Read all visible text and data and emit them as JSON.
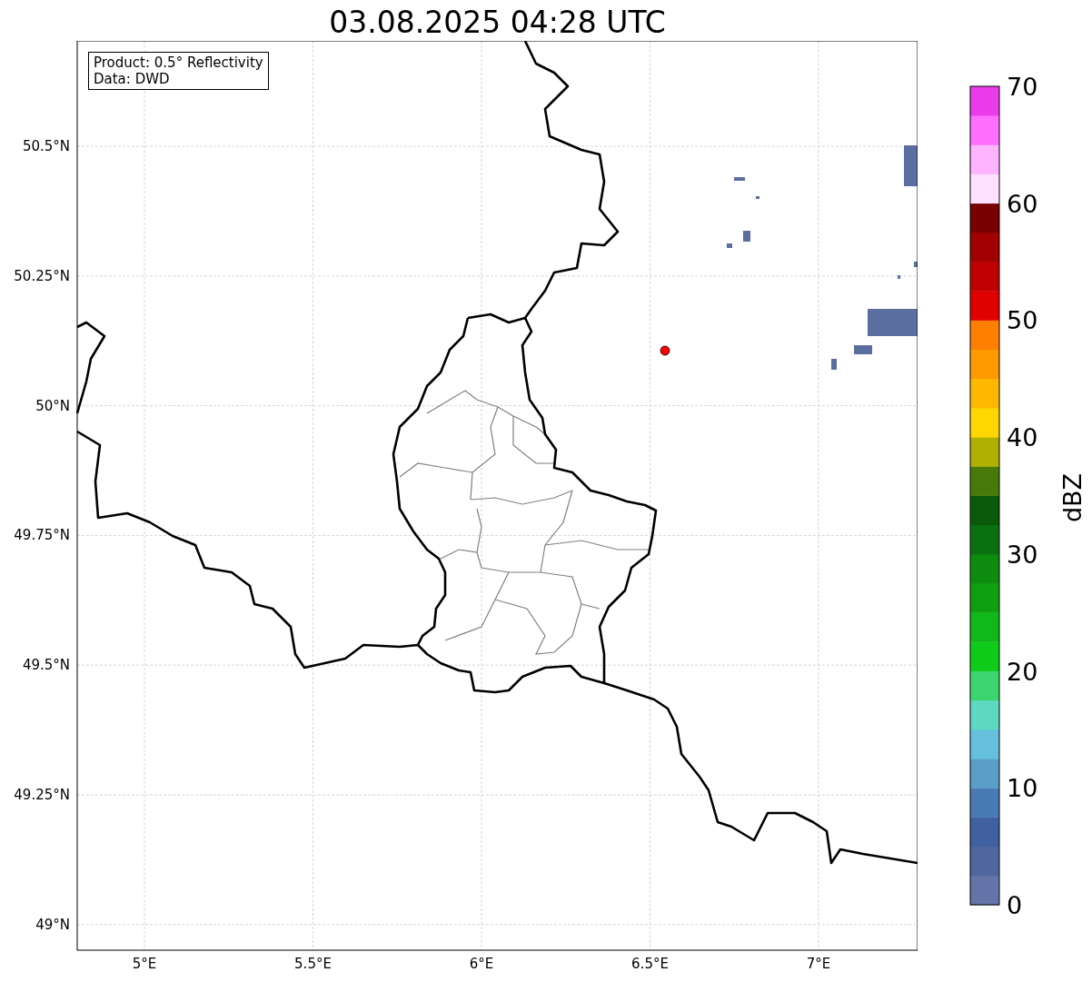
{
  "title": "03.08.2025 04:28 UTC",
  "info_box": [
    "Product: 0.5° Reflectivity",
    "Data: DWD"
  ],
  "map": {
    "x_ticks": [
      "5°E",
      "5.5°E",
      "6°E",
      "6.5°E",
      "7°E"
    ],
    "y_ticks": [
      "50.5°N",
      "50.25°N",
      "50°N",
      "49.75°N",
      "49.5°N",
      "49.25°N",
      "49°N"
    ]
  },
  "colorbar": {
    "label": "dBZ",
    "ticks": [
      "70",
      "60",
      "50",
      "40",
      "30",
      "20",
      "10",
      "0"
    ],
    "bins": [
      {
        "color": "#6474a8"
      },
      {
        "color": "#50669e"
      },
      {
        "color": "#4060a0"
      },
      {
        "color": "#4a7ab4"
      },
      {
        "color": "#5a9ec8"
      },
      {
        "color": "#64c0dc"
      },
      {
        "color": "#5ed8c0"
      },
      {
        "color": "#3cd46e"
      },
      {
        "color": "#10cc1a"
      },
      {
        "color": "#10b81a"
      },
      {
        "color": "#0fa010"
      },
      {
        "color": "#0d8c10"
      },
      {
        "color": "#0a7010"
      },
      {
        "color": "#0a5a0a"
      },
      {
        "color": "#487a0a"
      },
      {
        "color": "#b0b000"
      },
      {
        "color": "#ffd700"
      },
      {
        "color": "#ffb800"
      },
      {
        "color": "#ff9a00"
      },
      {
        "color": "#ff7f00"
      },
      {
        "color": "#e00000"
      },
      {
        "color": "#c00000"
      },
      {
        "color": "#a00000"
      },
      {
        "color": "#780000"
      },
      {
        "color": "#ffe0ff"
      },
      {
        "color": "#ffb4ff"
      },
      {
        "color": "#ff6eff"
      },
      {
        "color": "#ea3cea"
      }
    ]
  }
}
